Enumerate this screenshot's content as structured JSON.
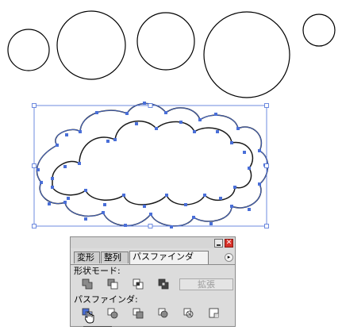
{
  "panel": {
    "tabs": [
      {
        "label": "変形",
        "active": false
      },
      {
        "label": "整列",
        "active": false
      },
      {
        "label": "パスファインダ",
        "active": true
      }
    ],
    "shape_modes_label": "形状モード:",
    "expand_label": "拡張",
    "pathfinders_label": "パスファインダ:",
    "close_glyph": "✕",
    "menu_glyph": "▸"
  },
  "colors": {
    "selection": "#4a6fd8",
    "stroke": "#000000",
    "panel_bg": "#dcdcdc",
    "close_button": "#d8322a"
  }
}
